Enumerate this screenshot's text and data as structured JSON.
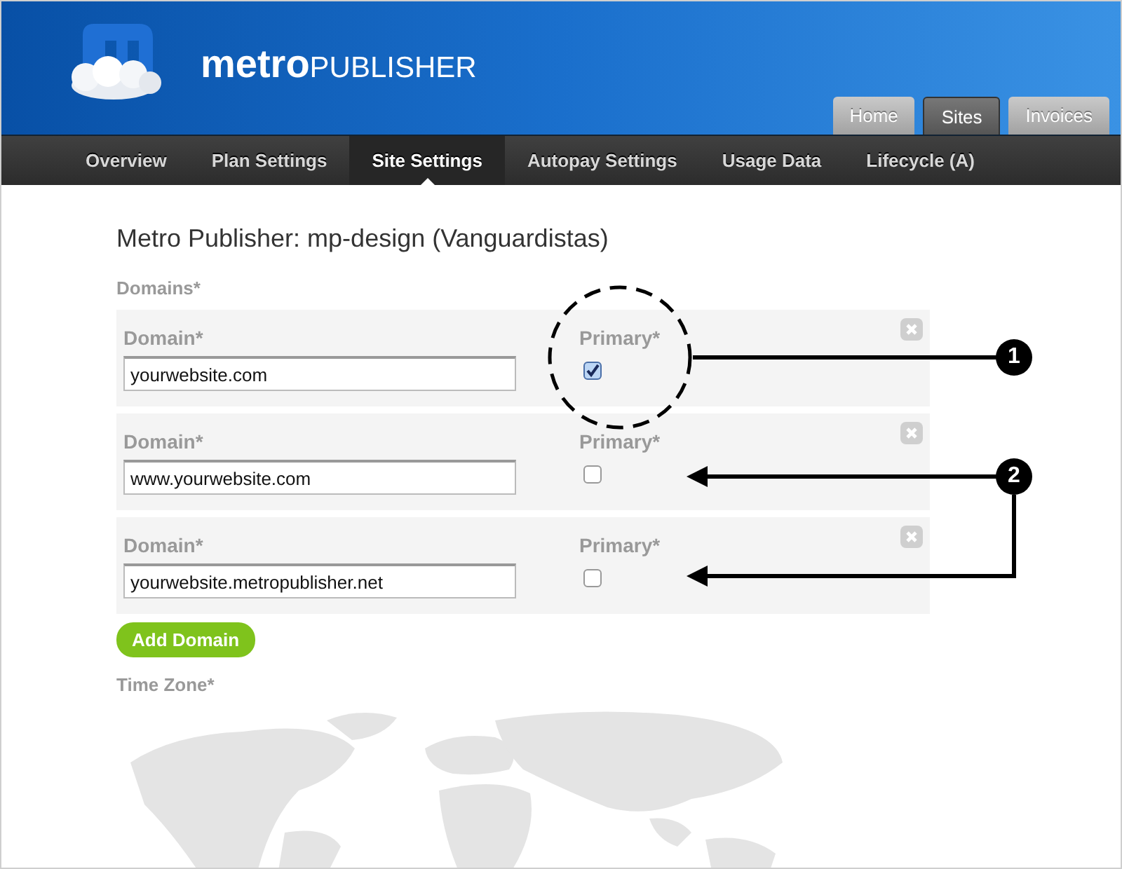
{
  "header": {
    "logo": "**metro**PUBLISHER",
    "tabs": [
      {
        "label": "Home",
        "selected": false
      },
      {
        "label": "Sites",
        "selected": true
      },
      {
        "label": "Invoices",
        "selected": false
      }
    ]
  },
  "nav": {
    "items": [
      {
        "label": "Overview",
        "selected": false
      },
      {
        "label": "Plan Settings",
        "selected": false
      },
      {
        "label": "Site Settings",
        "selected": true
      },
      {
        "label": "Autopay Settings",
        "selected": false
      },
      {
        "label": "Usage Data",
        "selected": false
      },
      {
        "label": "Lifecycle (A)",
        "selected": false
      }
    ]
  },
  "title": "Metro Publisher: mp-design (Vanguardistas)",
  "domains": {
    "label": "Domains*",
    "rows": [
      {
        "domain_label": "Domain*",
        "value": "yourwebsite.com",
        "primary_label": "Primary*",
        "primary": true
      },
      {
        "domain_label": "Domain*",
        "value": "www.yourwebsite.com",
        "primary_label": "Primary*",
        "primary": false
      },
      {
        "domain_label": "Domain*",
        "value": "yourwebsite.metropublisher.net",
        "primary_label": "Primary*",
        "primary": false
      }
    ]
  },
  "add_button": "Add Domain",
  "time_zone": {
    "label": "Time Zone*"
  },
  "annotations": [
    {
      "number": "1"
    },
    {
      "number": "2"
    }
  ]
}
